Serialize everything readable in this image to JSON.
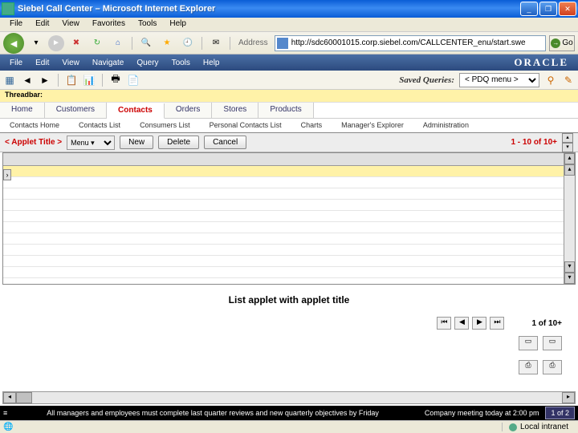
{
  "window": {
    "title": "Siebel Call Center – Microsoft Internet Explorer"
  },
  "ie_menu": [
    "File",
    "Edit",
    "View",
    "Favorites",
    "Tools",
    "Help"
  ],
  "address": {
    "label": "Address",
    "url": "http://sdc60001015.corp.siebel.com/CALLCENTER_enu/start.swe",
    "go": "Go"
  },
  "siebel_menu": [
    "File",
    "Edit",
    "View",
    "Navigate",
    "Query",
    "Tools",
    "Help"
  ],
  "oracle": "ORACLE",
  "saved_queries": {
    "label": "Saved Queries:",
    "value": "< PDQ menu >"
  },
  "threadbar": "Threadbar:",
  "screen_tabs": [
    "Home",
    "Customers",
    "Contacts",
    "Orders",
    "Stores",
    "Products"
  ],
  "active_screen": 2,
  "view_tabs": [
    "Contacts Home",
    "Contacts List",
    "Consumers List",
    "Personal Contacts List",
    "Charts",
    "Manager's Explorer",
    "Administration"
  ],
  "applet": {
    "title": "< Applet Title >",
    "menu": "Menu ▾",
    "buttons": {
      "new": "New",
      "delete": "Delete",
      "cancel": "Cancel"
    },
    "counter": "1 - 10 of  10+"
  },
  "caption": "List applet with applet title",
  "pager": {
    "label": "1  of  10+"
  },
  "status": {
    "msg1": "All managers and employees must complete last quarter reviews and new quarterly objectives by Friday",
    "msg2": "Company meeting today at 2:00 pm",
    "pagecount": "1 of 2"
  },
  "ie_status": {
    "zone": "Local intranet"
  }
}
